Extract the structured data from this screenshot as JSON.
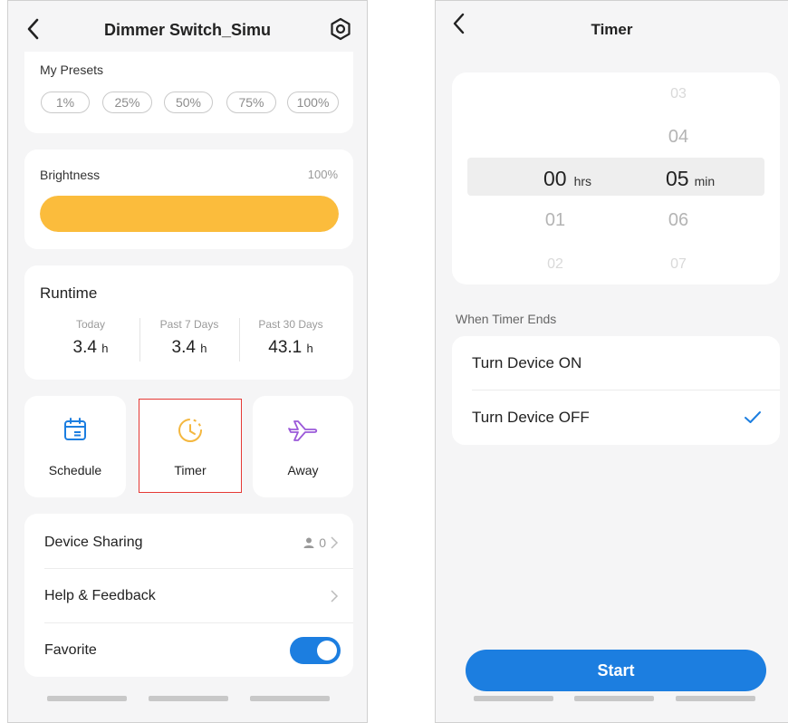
{
  "left": {
    "header": {
      "title": "Dimmer Switch_Simu"
    },
    "presets": {
      "title": "My Presets",
      "items": [
        "1%",
        "25%",
        "50%",
        "75%",
        "100%"
      ]
    },
    "brightness": {
      "label": "Brightness",
      "value": "100%",
      "level": 1.0,
      "color": "#fbbc3c"
    },
    "runtime": {
      "title": "Runtime",
      "cols": [
        {
          "label": "Today",
          "value": "3.4",
          "unit": "h"
        },
        {
          "label": "Past 7 Days",
          "value": "3.4",
          "unit": "h"
        },
        {
          "label": "Past 30 Days",
          "value": "43.1",
          "unit": "h"
        }
      ]
    },
    "tiles": [
      {
        "label": "Schedule",
        "icon": "calendar-icon"
      },
      {
        "label": "Timer",
        "icon": "timer-icon"
      },
      {
        "label": "Away",
        "icon": "airplane-icon"
      }
    ],
    "settings": {
      "sharing": {
        "label": "Device Sharing",
        "count": "0"
      },
      "help": {
        "label": "Help & Feedback"
      },
      "favorite": {
        "label": "Favorite",
        "enabled": true
      }
    },
    "colors": {
      "accent": "#1c7ee0",
      "highlight": "#e53935"
    }
  },
  "right": {
    "header": {
      "title": "Timer"
    },
    "picker": {
      "hours": {
        "above": "",
        "selected": "00",
        "unit": "hrs",
        "below1": "01",
        "below2": "02"
      },
      "minutes": {
        "above2": "03",
        "above1": "04",
        "selected": "05",
        "unit": "min",
        "below1": "06",
        "below2": "07"
      }
    },
    "when_ends": {
      "title": "When Timer Ends",
      "options": [
        {
          "label": "Turn Device ON",
          "checked": false
        },
        {
          "label": "Turn Device OFF",
          "checked": true
        }
      ]
    },
    "start_label": "Start"
  }
}
